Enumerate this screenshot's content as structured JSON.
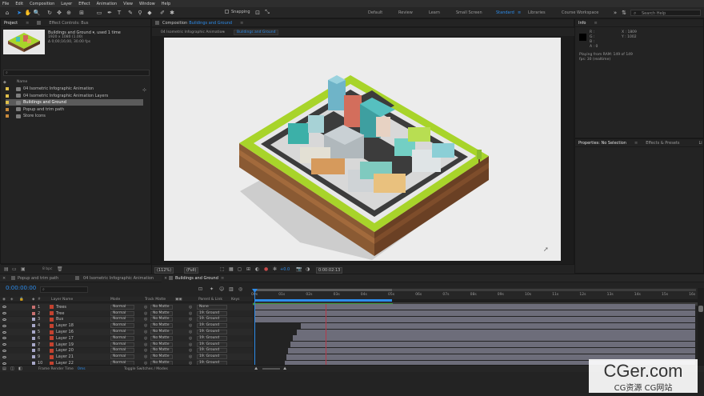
{
  "menu": [
    "File",
    "Edit",
    "Composition",
    "Layer",
    "Effect",
    "Animation",
    "View",
    "Window",
    "Help"
  ],
  "toolbar": {
    "snapping_label": "Snapping",
    "workspaces": [
      "Default",
      "Review",
      "Learn",
      "Small Screen",
      "Standard",
      "Libraries",
      "Course Workspace"
    ],
    "active_workspace": "Standard",
    "search_placeholder": "Search Help"
  },
  "project_panel": {
    "tab_project": "Project",
    "tab_effect_controls": "Effect Controls: Bus",
    "selected_name": "Buildings and Ground ▾, used 1 time",
    "selected_size": "1920 x 1080 (1.00)",
    "selected_duration": "Δ 0;00;16;00, 30.00 fps",
    "column_name": "Name",
    "items": [
      {
        "label": "04 Isometric Infographic Animation",
        "color": "#e0c04a",
        "type": "comp"
      },
      {
        "label": "04 Isometric Infographic Animation Layers",
        "color": "#e0c04a",
        "type": "folder"
      },
      {
        "label": "Buildings and Ground",
        "color": "#e0c04a",
        "type": "comp",
        "selected": true
      },
      {
        "label": "Popup and trim path",
        "color": "#c98a3c",
        "type": "comp"
      },
      {
        "label": "Store Icons",
        "color": "#c98a3c",
        "type": "comp"
      }
    ],
    "footer_bpc": "8 bpc"
  },
  "composition_panel": {
    "tab_label": "Composition",
    "tab_name": "Buildings and Ground",
    "breadcrumbs": [
      "04 Isometric Infographic Animation",
      "Buildings and Ground"
    ],
    "zoom": "(112%)",
    "resolution": "(Full)",
    "exposure": "+0.0",
    "timecode": "0:00:02:13"
  },
  "info_panel": {
    "title": "Info",
    "r_label": "R :",
    "g_label": "G :",
    "b_label": "B :",
    "a_label": "A : 0",
    "x_value": "X : 1809",
    "y_value": "Y : 1002",
    "status_1": "Playing from RAM: 149 of 149",
    "status_2": "fps: 30 (realtime)"
  },
  "properties_panel": {
    "tab_properties": "Properties: No Selection",
    "tab_effects": "Effects & Presets",
    "tab_lib": "Li"
  },
  "timeline": {
    "tabs": [
      "Popup and trim path",
      "04 Isometric Infographic Animation",
      "Buildings and Ground"
    ],
    "active_tab": "Buildings and Ground",
    "current_time": "0:00:00:00",
    "columns": {
      "layer_name": "Layer Name",
      "mode": "Mode",
      "track_matte": "Track Matte",
      "parent": "Parent & Link",
      "keys": "Keys"
    },
    "ruler": [
      "00s",
      "01s",
      "02s",
      "03s",
      "04s",
      "05s",
      "06s",
      "07s",
      "08s",
      "09s",
      "10s",
      "11s",
      "12s",
      "13s",
      "14s",
      "15s",
      "16s"
    ],
    "layers": [
      {
        "index": "1",
        "name": "Trees",
        "mode": "Normal",
        "matte": "No Matte",
        "parent": "None",
        "color": "#c87070"
      },
      {
        "index": "2",
        "name": "Tree",
        "mode": "Normal",
        "matte": "No Matte",
        "parent": "19. Ground",
        "color": "#c87070"
      },
      {
        "index": "3",
        "name": "Bus",
        "mode": "Normal",
        "matte": "No Matte",
        "parent": "19. Ground",
        "color": "#a8a8c8"
      },
      {
        "index": "4",
        "name": "Layer 18",
        "mode": "Normal",
        "matte": "No Matte",
        "parent": "19. Ground",
        "color": "#a8a8c8"
      },
      {
        "index": "5",
        "name": "Layer 16",
        "mode": "Normal",
        "matte": "No Matte",
        "parent": "19. Ground",
        "color": "#a8a8c8"
      },
      {
        "index": "6",
        "name": "Layer 17",
        "mode": "Normal",
        "matte": "No Matte",
        "parent": "19. Ground",
        "color": "#a8a8c8"
      },
      {
        "index": "7",
        "name": "Layer 19",
        "mode": "Normal",
        "matte": "No Matte",
        "parent": "19. Ground",
        "color": "#a8a8c8"
      },
      {
        "index": "8",
        "name": "Layer 20",
        "mode": "Normal",
        "matte": "No Matte",
        "parent": "19. Ground",
        "color": "#a8a8c8"
      },
      {
        "index": "9",
        "name": "Layer 21",
        "mode": "Normal",
        "matte": "No Matte",
        "parent": "19. Ground",
        "color": "#a8a8c8"
      },
      {
        "index": "10",
        "name": "Layer 22",
        "mode": "Normal",
        "matte": "No Matte",
        "parent": "19. Ground",
        "color": "#a8a8c8"
      }
    ],
    "footer_left": "Frame Render Time",
    "footer_time": "0ms",
    "footer_toggle": "Toggle Switches / Modes"
  },
  "watermark": {
    "main": "CGer.com",
    "sub": "CG资源 CG网站"
  }
}
